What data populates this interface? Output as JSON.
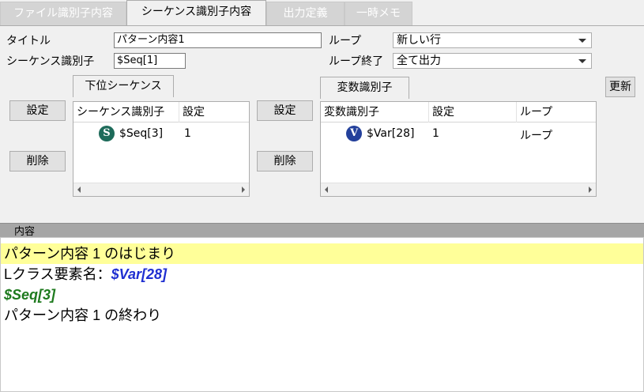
{
  "tabs": [
    {
      "label": "ファイル識別子内容",
      "active": false
    },
    {
      "label": "シーケンス識別子内容",
      "active": true
    },
    {
      "label": "出力定義",
      "active": false
    },
    {
      "label": "一時メモ",
      "active": false
    }
  ],
  "form": {
    "title_label": "タイトル",
    "title_value": "パターン内容1",
    "seq_id_label": "シーケンス識別子",
    "seq_id_value": "$Seq[1]",
    "loop_label": "ループ",
    "loop_value": "新しい行",
    "loop_end_label": "ループ終了",
    "loop_end_value": "全て出力"
  },
  "buttons": {
    "set_left": "設定",
    "delete_left": "削除",
    "set_right": "設定",
    "delete_right": "削除",
    "update": "更新"
  },
  "sub_sequence": {
    "tab_label": "下位シーケンス",
    "columns": [
      "シーケンス識別子",
      "設定"
    ],
    "rows": [
      {
        "icon": "S",
        "id": "$Seq[3]",
        "setting": "1"
      }
    ]
  },
  "variables": {
    "tab_label": "変数識別子",
    "columns": [
      "変数識別子",
      "設定",
      "ループ"
    ],
    "rows": [
      {
        "icon": "V",
        "id": "$Var[28]",
        "setting": "1",
        "loop": "ループ"
      }
    ]
  },
  "content": {
    "header": "内容",
    "line1": "パターン内容 1 のはじまり",
    "line2_prefix": "Lクラス要素名：",
    "line2_var": "$Var[28]",
    "line3_seq": "$Seq[3]",
    "line4": "パターン内容 1 の終わり"
  },
  "colors": {
    "seq_badge": "#1e6b5a",
    "var_badge": "#23409b",
    "highlight": "#ffff99",
    "var_text": "#1f2fd1",
    "seq_text": "#1e7a1e"
  }
}
